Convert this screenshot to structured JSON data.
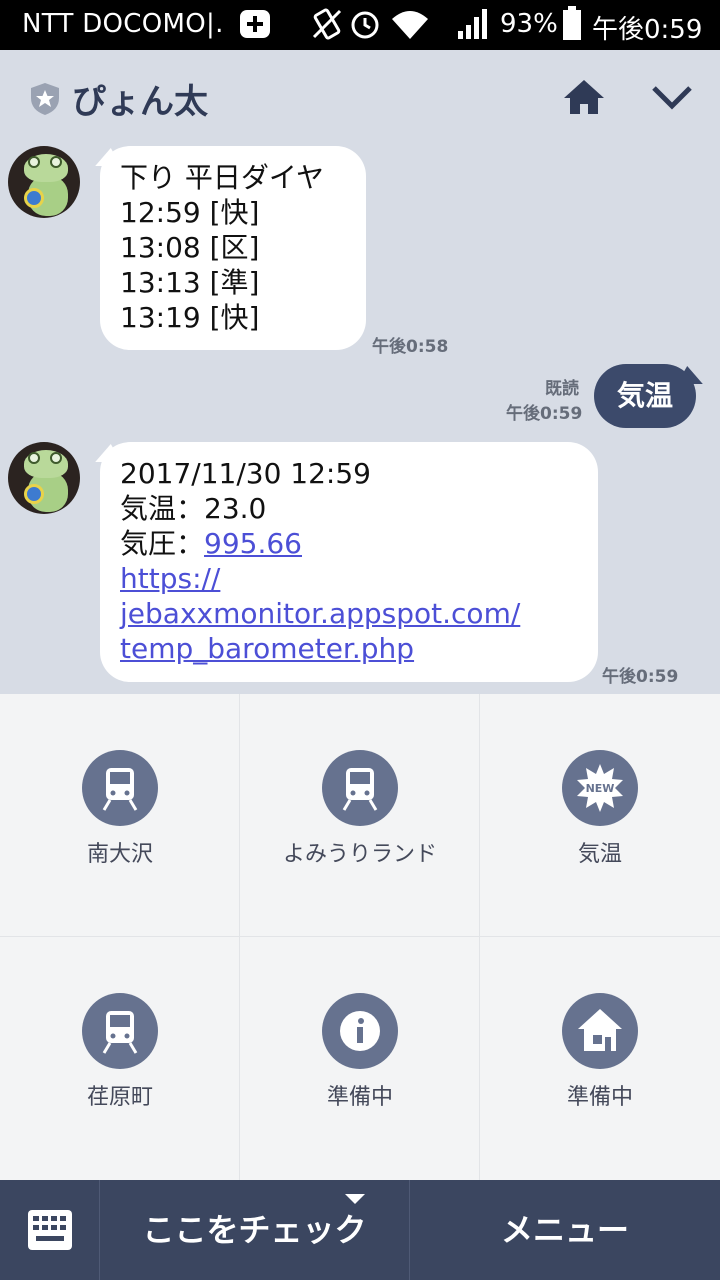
{
  "status_bar": {
    "carrier": "NTT DOCOMO|.",
    "battery_pct": "93%",
    "clock": "午後0:59"
  },
  "header": {
    "title": "ぴょん太"
  },
  "messages": [
    {
      "from": "bot",
      "lines": [
        "下り 平日ダイヤ",
        "12:59 [快]",
        "13:08 [区]",
        "13:13 [準]",
        "13:19 [快]"
      ],
      "time": "午後0:58"
    },
    {
      "from": "me",
      "text": "気温",
      "read": "既読",
      "time": "午後0:59"
    },
    {
      "from": "bot",
      "line1": "2017/11/30 12:59",
      "line2": "気温：23.0",
      "line3_prefix": "気圧：",
      "line3_link": "995.66",
      "link_lines": [
        "https://",
        "jebaxxmonitor.appspot.com/",
        "temp_barometer.php"
      ],
      "time": "午後0:59"
    }
  ],
  "rich_menu": {
    "items": [
      {
        "label": "南大沢",
        "icon": "train-icon"
      },
      {
        "label": "よみうりランド",
        "icon": "train-icon"
      },
      {
        "label": "気温",
        "icon": "new-badge-icon",
        "badge": "NEW"
      },
      {
        "label": "荏原町",
        "icon": "train-icon"
      },
      {
        "label": "準備中",
        "icon": "info-icon"
      },
      {
        "label": "準備中",
        "icon": "house-icon"
      }
    ]
  },
  "bottom_bar": {
    "check_label": "ここをチェック",
    "menu_label": "メニュー"
  },
  "colors": {
    "chat_bg": "#d7dce5",
    "accent": "#3b4660",
    "my_bubble": "#3c4a6b",
    "icon_circle": "#66728f",
    "link": "#4c4fd6"
  }
}
